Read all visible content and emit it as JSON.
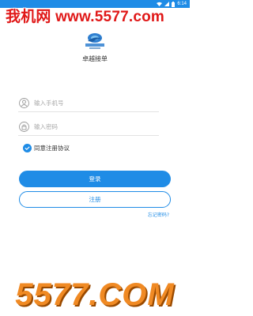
{
  "status_bar": {
    "time": "6:14"
  },
  "watermark": {
    "top_text": "我机网 www.5577.com",
    "bottom_text": "5577.COM"
  },
  "app": {
    "logo_text": "卓越接单",
    "title": "卓越接单"
  },
  "form": {
    "phone": {
      "placeholder": "输入手机号",
      "value": ""
    },
    "password": {
      "placeholder": "输入密码",
      "value": ""
    },
    "agree_label": "同意注册协议",
    "agree_checked": true
  },
  "buttons": {
    "login": "登录",
    "register": "注册"
  },
  "forgot_label": "忘记密码?",
  "colors": {
    "accent": "#1f8ce6",
    "watermark_red": "#e01818",
    "watermark_orange": "#f08a24"
  }
}
